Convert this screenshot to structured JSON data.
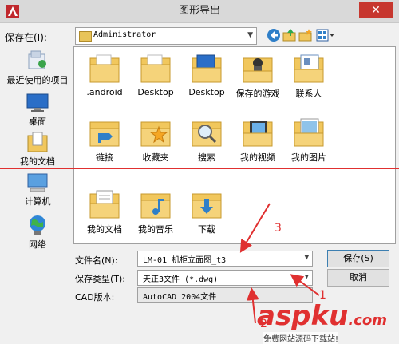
{
  "window": {
    "title": "图形导出",
    "close_glyph": "✕"
  },
  "lookin": {
    "label": "保存在(I):",
    "value": "Administrator"
  },
  "places": [
    {
      "label": "最近使用的项目",
      "icon": "recent-icon"
    },
    {
      "label": "桌面",
      "icon": "desktop-icon"
    },
    {
      "label": "我的文档",
      "icon": "documents-icon"
    },
    {
      "label": "计算机",
      "icon": "computer-icon"
    },
    {
      "label": "网络",
      "icon": "network-icon"
    }
  ],
  "files": [
    {
      "name": ".android",
      "icon": "folder-icon"
    },
    {
      "name": "Desktop",
      "icon": "folder-icon"
    },
    {
      "name": "Desktop",
      "icon": "desktop-folder-icon"
    },
    {
      "name": "保存的游戏",
      "icon": "games-folder-icon"
    },
    {
      "name": "联系人",
      "icon": "contacts-folder-icon"
    },
    {
      "name": "链接",
      "icon": "links-folder-icon"
    },
    {
      "name": "收藏夹",
      "icon": "favorites-folder-icon"
    },
    {
      "name": "搜索",
      "icon": "search-folder-icon"
    },
    {
      "name": "我的视频",
      "icon": "videos-folder-icon"
    },
    {
      "name": "我的图片",
      "icon": "pictures-folder-icon"
    },
    {
      "name": "我的文档",
      "icon": "documents-folder-icon"
    },
    {
      "name": "我的音乐",
      "icon": "music-folder-icon"
    },
    {
      "name": "下载",
      "icon": "downloads-folder-icon"
    }
  ],
  "form": {
    "filename_label": "文件名(N):",
    "filename_value": "LM-01 机柜立面图_t3",
    "filetype_label": "保存类型(T):",
    "filetype_value": "天正3文件 (*.dwg)",
    "cadver_label": "CAD版本:",
    "cadver_value": "AutoCAD 2004文件"
  },
  "buttons": {
    "save": "保存(S)",
    "cancel": "取消"
  },
  "annotations": {
    "n1": "1",
    "n2": "2",
    "n3": "3"
  },
  "watermark": {
    "brand": "aspku",
    "suffix": ".com",
    "tagline": "免费网站源码下载站!"
  },
  "colors": {
    "accent": "#e03030",
    "folder": "#f1c75d",
    "close": "#c7372f"
  }
}
